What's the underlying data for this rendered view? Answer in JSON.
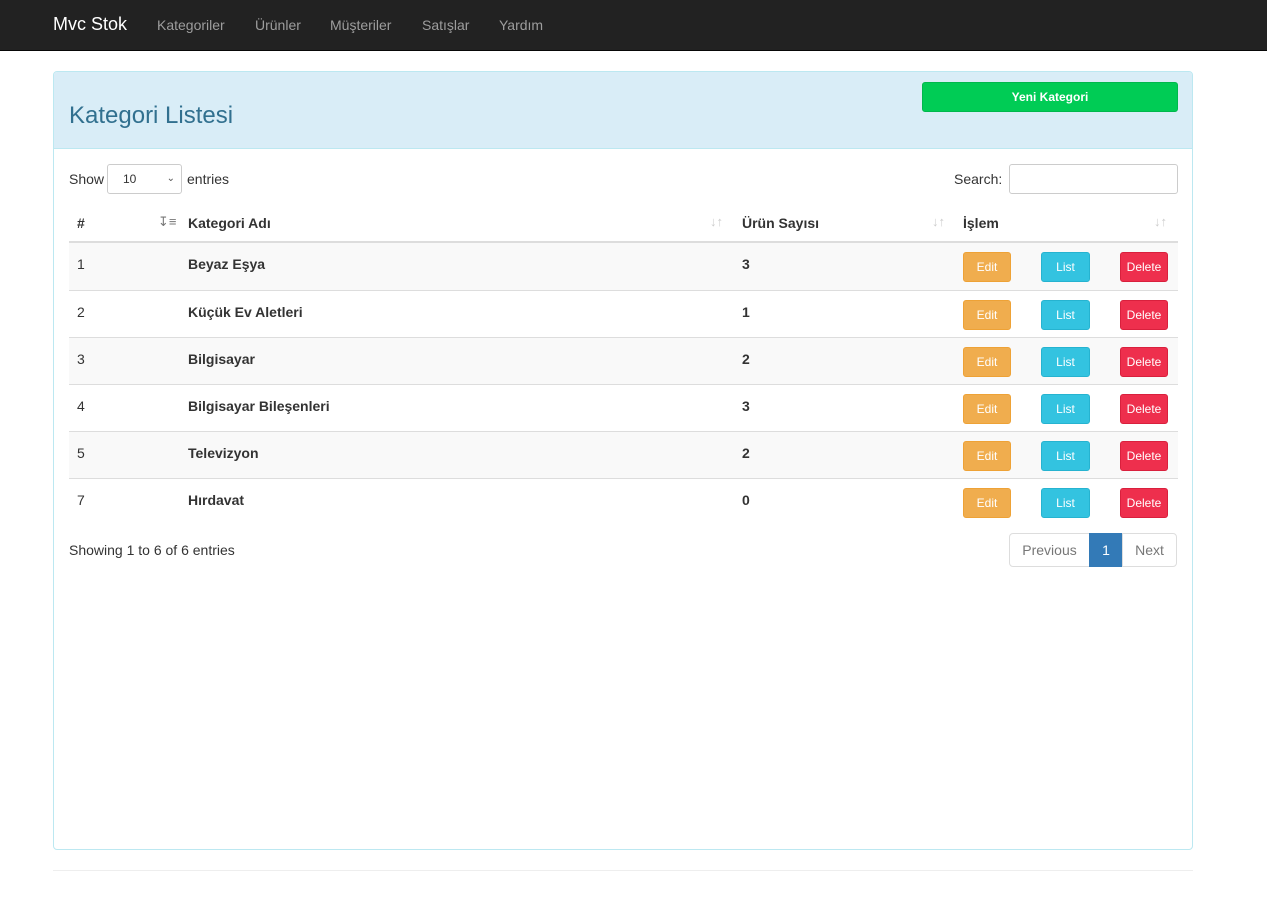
{
  "nav": {
    "brand": "Mvc Stok",
    "items": [
      {
        "label": "Kategoriler"
      },
      {
        "label": "Ürünler"
      },
      {
        "label": "Müşteriler"
      },
      {
        "label": "Satışlar"
      },
      {
        "label": "Yardım"
      }
    ]
  },
  "panel": {
    "title": "Kategori Listesi",
    "new_button": "Yeni Kategori"
  },
  "table_controls": {
    "show_label": "Show",
    "page_size": "10",
    "entries_label": "entries",
    "search_label": "Search:",
    "search_value": ""
  },
  "table": {
    "columns": [
      "#",
      "Kategori Adı",
      "Ürün Sayısı",
      "İşlem"
    ],
    "rows": [
      {
        "id": "1",
        "name": "Beyaz Eşya",
        "count": "3"
      },
      {
        "id": "2",
        "name": "Küçük Ev Aletleri",
        "count": "1"
      },
      {
        "id": "3",
        "name": "Bilgisayar",
        "count": "2"
      },
      {
        "id": "4",
        "name": "Bilgisayar Bileşenleri",
        "count": "3"
      },
      {
        "id": "5",
        "name": "Televizyon",
        "count": "2"
      },
      {
        "id": "7",
        "name": "Hırdavat",
        "count": "0"
      }
    ],
    "actions": {
      "edit": "Edit",
      "list": "List",
      "delete": "Delete"
    }
  },
  "footer": {
    "info": "Showing 1 to 6 of 6 entries",
    "previous": "Previous",
    "current_page": "1",
    "next": "Next"
  },
  "icons": {
    "sort_active": "sort-amount-asc-icon",
    "sort": "sort-icon",
    "select": "chevron-down-icon"
  },
  "colors": {
    "navbar": "#222222",
    "panel_heading": "#d9edf7",
    "new_button": "#00cc55",
    "edit": "#f0ad4e",
    "list": "#33c3e0",
    "delete": "#ee2f4d",
    "page_active": "#337ab7"
  }
}
